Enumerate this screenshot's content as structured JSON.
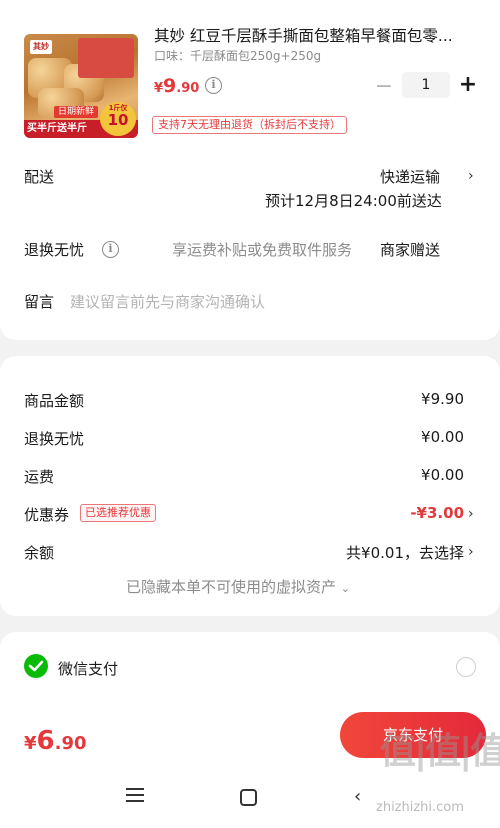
{
  "product": {
    "title": "其妙 红豆千层酥手撕面包整箱早餐面包零...",
    "flavor": "口味：千层酥面包250g+250g",
    "price_currency": "¥",
    "price_int": "9",
    "price_dec": ".90",
    "quantity": "1",
    "minus": "−",
    "plus": "+",
    "return_tag": "支持7天无理由退货（拆封后不支持）",
    "image_fresh": "日期新鲜",
    "image_promo": "买半斤送半斤",
    "image_badge_top": "1斤仅",
    "image_badge_num": "10",
    "image_logo": "其妙"
  },
  "delivery": {
    "label": "配送",
    "method": "快递运输",
    "eta": "预计12月8日24:00前送达"
  },
  "return_worry_free": {
    "label": "退换无忧",
    "desc": "享运费补贴或免费取件服务",
    "gift": "商家赠送"
  },
  "message": {
    "label": "留言",
    "placeholder": "建议留言前先与商家沟通确认"
  },
  "summary": {
    "rows": [
      {
        "label": "商品金额",
        "value": "¥9.90"
      },
      {
        "label": "退换无忧",
        "value": "¥0.00"
      },
      {
        "label": "运费",
        "value": "¥0.00"
      },
      {
        "label": "优惠券",
        "value": "-¥3.00",
        "tag": "已选推荐优惠"
      },
      {
        "label": "余额",
        "value": "共¥0.01，去选择"
      }
    ],
    "hidden_assets": "已隐藏本单不可使用的虚拟资产"
  },
  "payment": {
    "method": "微信支付"
  },
  "footer": {
    "total_currency": "¥",
    "total_int": "6",
    "total_dec": ".90",
    "pay_button": "京东支付"
  },
  "watermark": {
    "brand": "值|值|值",
    "url": "zhizhizhi.com"
  },
  "colors": {
    "accent": "#e4393c",
    "wechat": "#09bb07"
  }
}
